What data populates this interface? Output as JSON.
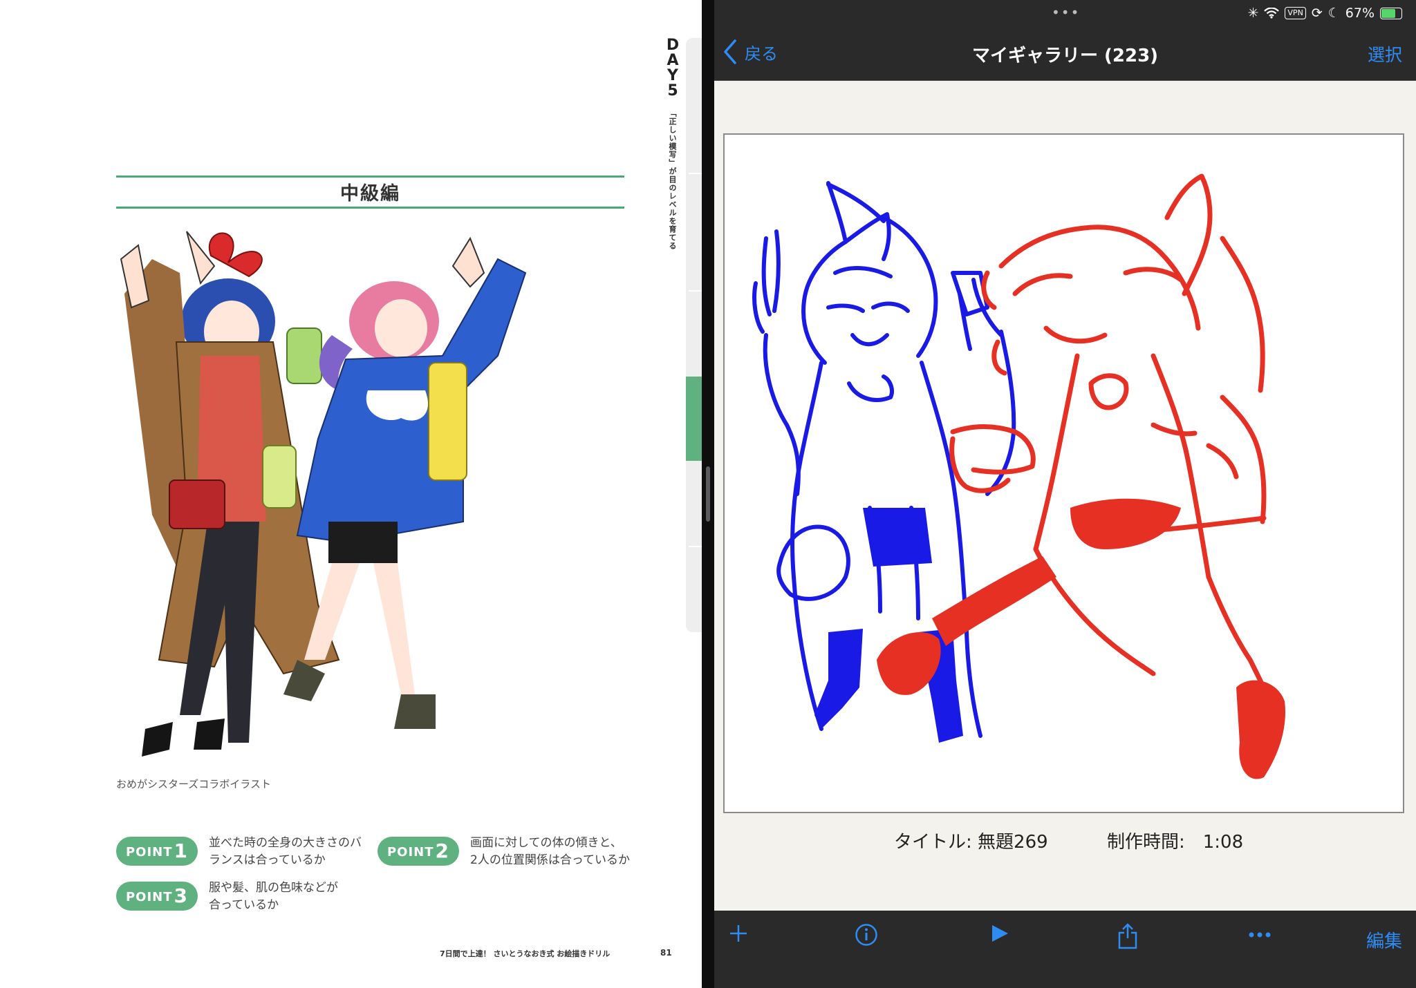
{
  "book": {
    "section_title": "中級編",
    "caption": "おめがシスターズコラボイラスト",
    "day_label": "DAY5",
    "day_subtitle": "「正しい模写」が目のレベルを育てる",
    "points": [
      {
        "label": "POINT",
        "num": "1",
        "text": "並べた時の全身の大きさのバ\nランスは合っているか"
      },
      {
        "label": "POINT",
        "num": "2",
        "text": "画面に対しての体の傾きと、\n2人の位置関係は合っているか"
      },
      {
        "label": "POINT",
        "num": "3",
        "text": "服や髪、肌の色味などが\n合っているか"
      }
    ],
    "footer_title": "7日間で上達！ さいとうなおき式 お絵描きドリル",
    "page_number": "81",
    "accent_color": "#5fb27f"
  },
  "status_bar": {
    "battery": "67%",
    "vpn": "VPN",
    "icons": [
      "loading-icon",
      "wifi-icon",
      "vpn-icon",
      "lock-rotation-icon",
      "moon-icon",
      "battery-icon"
    ]
  },
  "nav": {
    "back_label": "戻る",
    "title": "マイギャラリー (223)",
    "select_label": "選択"
  },
  "artwork": {
    "title_label": "タイトル: 無題269",
    "time_label": "制作時間:　1:08",
    "stroke_colors": [
      "#1a1ae6",
      "#e63024"
    ]
  },
  "toolbar": {
    "items": [
      "add-icon",
      "info-icon",
      "play-icon",
      "share-icon",
      "more-icon"
    ],
    "edit_label": "編集"
  }
}
